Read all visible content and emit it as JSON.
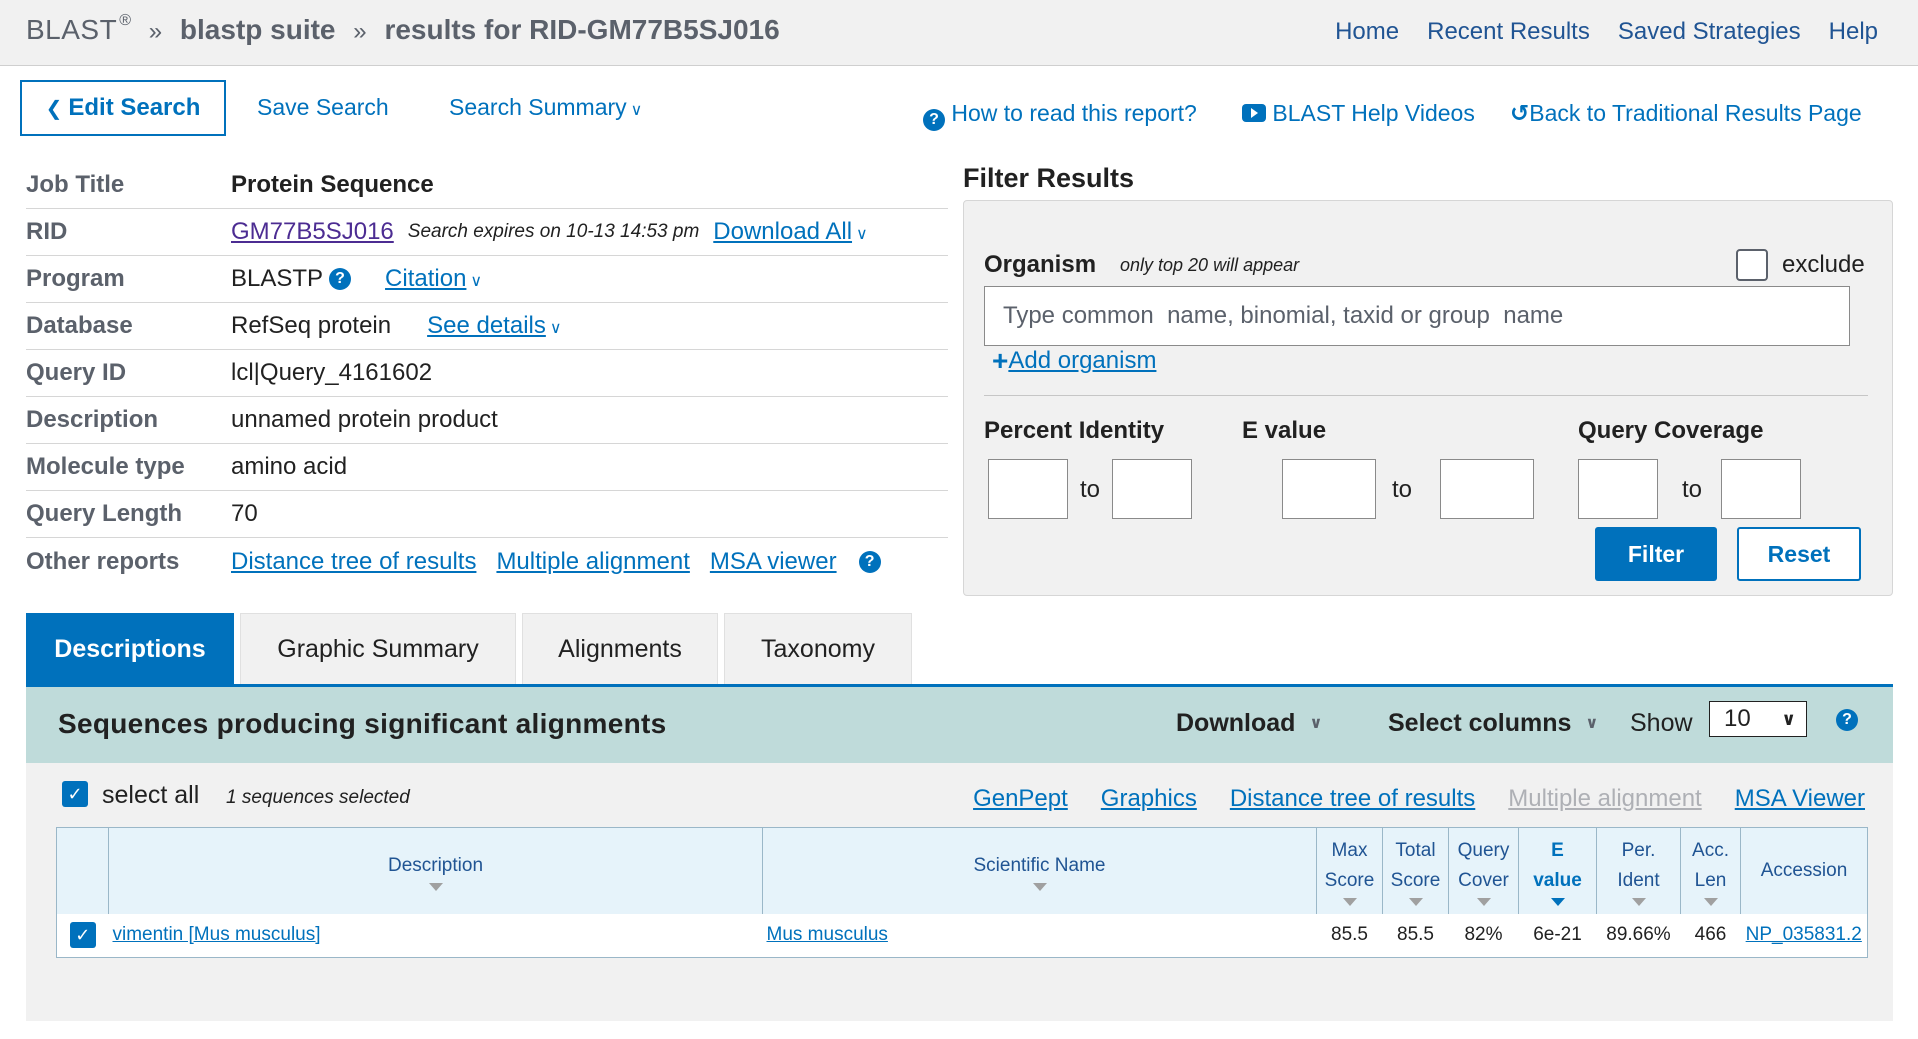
{
  "header": {
    "brand": "BLAST",
    "brand_mark": "®",
    "sep": "»",
    "crumb_suite": "blastp suite",
    "crumb_results": "results for RID-GM77B5SJ016",
    "nav": [
      "Home",
      "Recent Results",
      "Saved Strategies",
      "Help"
    ]
  },
  "toolbar": {
    "edit_search": "Edit Search",
    "save_search": "Save Search",
    "search_summary": "Search Summary",
    "how_to_read": "How to read this report?",
    "help_videos": "BLAST Help Videos",
    "back_traditional": "Back to Traditional Results Page"
  },
  "job": {
    "title_label": "Job Title",
    "title_value": "Protein Sequence",
    "rid_label": "RID",
    "rid_value": "GM77B5SJ016",
    "rid_expires": "Search expires on 10-13 14:53 pm",
    "download_all": "Download All",
    "program_label": "Program",
    "program_value": "BLASTP",
    "citation": "Citation",
    "database_label": "Database",
    "database_value": "RefSeq protein",
    "see_details": "See details",
    "query_id_label": "Query ID",
    "query_id_value": "lcl|Query_4161602",
    "description_label": "Description",
    "description_value": "unnamed protein product",
    "molecule_label": "Molecule type",
    "molecule_value": "amino acid",
    "query_length_label": "Query Length",
    "query_length_value": "70",
    "other_reports_label": "Other reports",
    "other_reports": [
      "Distance tree of results",
      "Multiple alignment",
      "MSA viewer"
    ]
  },
  "filter": {
    "title": "Filter Results",
    "organism_label": "Organism",
    "organism_note": "only top 20 will appear",
    "exclude_label": "exclude",
    "organism_placeholder": "Type common  name, binomial, taxid or group  name",
    "add_organism": "Add organism",
    "percent_identity": "Percent Identity",
    "e_value": "E value",
    "query_coverage": "Query Coverage",
    "to": "to",
    "filter_btn": "Filter",
    "reset_btn": "Reset"
  },
  "tabs": [
    "Descriptions",
    "Graphic Summary",
    "Alignments",
    "Taxonomy"
  ],
  "results": {
    "title": "Sequences producing significant alignments",
    "download": "Download",
    "select_columns": "Select columns",
    "show_label": "Show",
    "show_value": "10",
    "select_all": "select all",
    "selected_count": "1 sequences selected",
    "links": [
      "GenPept",
      "Graphics",
      "Distance tree of results",
      "Multiple alignment",
      "MSA Viewer"
    ],
    "columns": {
      "description": "Description",
      "scientific_name": "Scientific Name",
      "max_score_1": "Max",
      "max_score_2": "Score",
      "total_score_1": "Total",
      "total_score_2": "Score",
      "query_cover_1": "Query",
      "query_cover_2": "Cover",
      "e_value_1": "E",
      "e_value_2": "value",
      "per_ident_1": "Per.",
      "per_ident_2": "Ident",
      "acc_len_1": "Acc.",
      "acc_len_2": "Len",
      "accession": "Accession"
    },
    "rows": [
      {
        "description": "vimentin [Mus musculus]",
        "scientific_name": "Mus musculus",
        "max_score": "85.5",
        "total_score": "85.5",
        "query_cover": "82%",
        "e_value": "6e-21",
        "per_ident": "89.66%",
        "acc_len": "466",
        "accession": "NP_035831.2"
      }
    ]
  }
}
